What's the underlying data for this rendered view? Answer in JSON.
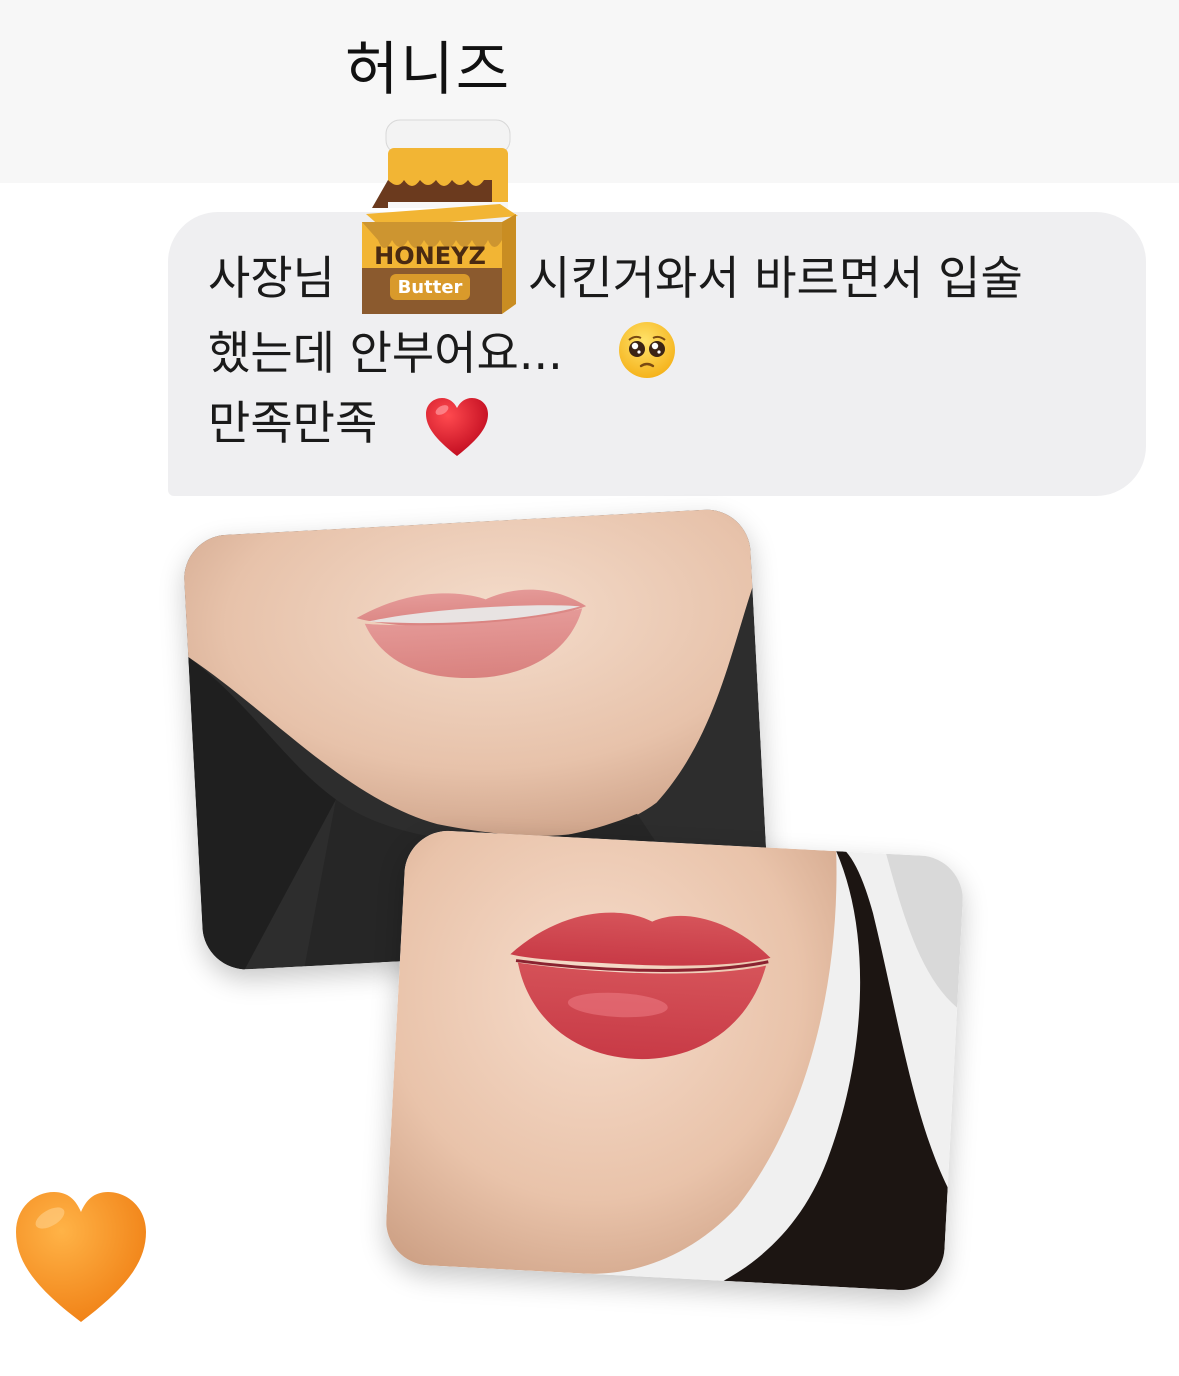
{
  "chat": {
    "sender_name": "허니즈",
    "message": {
      "line1_before": "사장님",
      "line1_after": "시킨거와서 바르면서 입술",
      "line2": "했는데 안부어요...",
      "line3": "만족만족"
    },
    "message_emojis": [
      "pleading-face-emoji",
      "red-heart-emoji"
    ],
    "product_sticker": {
      "brand": "HONEYZ",
      "name": "Butter"
    },
    "photos": [
      "before-lips-photo",
      "after-lips-photo"
    ],
    "reaction": "orange-heart-emoji"
  },
  "colors": {
    "bubble": "#efeff1",
    "top_band": "#f7f7f7",
    "honey": "#f2b534",
    "chocolate": "#6b3a1e",
    "orange_heart": "#f7921e",
    "red_heart": "#d9142b"
  }
}
